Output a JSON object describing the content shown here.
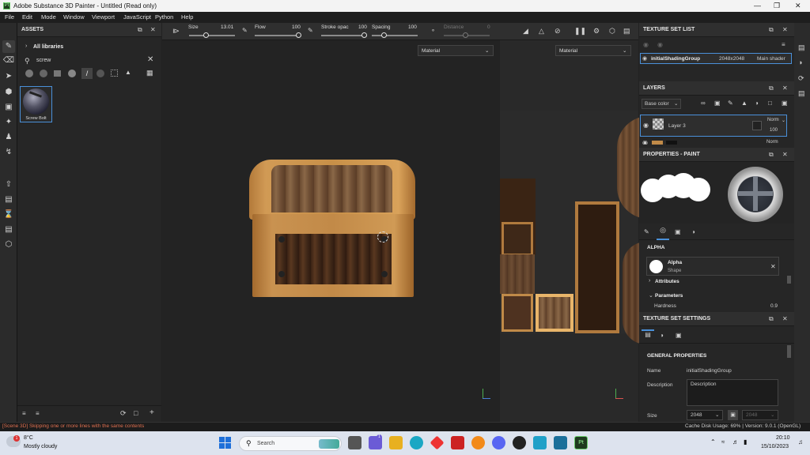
{
  "window": {
    "title": "Adobe Substance 3D Painter - Untitled (Read only)",
    "app_icon": "Pt"
  },
  "menu": [
    "File",
    "Edit",
    "Mode",
    "Window",
    "Viewport",
    "JavaScript",
    "Python",
    "Help"
  ],
  "assets": {
    "header": "ASSETS",
    "library": "All libraries",
    "search_value": "screw",
    "items": [
      {
        "label": "Screw Bolt"
      }
    ]
  },
  "toolbar": {
    "size_label": "Size",
    "size_value": "13.01",
    "flow_label": "Flow",
    "flow_value": "100",
    "stroke_label": "Stroke opac",
    "stroke_value": "100",
    "spacing_label": "Spacing",
    "spacing_value": "100",
    "distance_label": "Distance",
    "distance_value": "0"
  },
  "viewport": {
    "left_mode": "Material",
    "right_mode": "Material"
  },
  "texture_set_list": {
    "header": "TEXTURE SET LIST",
    "name": "initialShadingGroup",
    "resolution": "2048x2048",
    "shader": "Main shader"
  },
  "layers": {
    "header": "LAYERS",
    "channel": "Base color",
    "items": [
      {
        "name": "Layer 3",
        "blend": "Norm",
        "opacity": "100"
      },
      {
        "name": "",
        "blend": "Norm",
        "opacity": ""
      }
    ]
  },
  "properties": {
    "header": "PROPERTIES - PAINT",
    "alpha_section": "ALPHA",
    "alpha_name": "Alpha",
    "alpha_sub": "Shape",
    "attributes": "Attributes",
    "parameters": "Parameters",
    "hardness_label": "Hardness",
    "hardness_value": "0.9"
  },
  "texture_set_settings": {
    "header": "TEXTURE SET SETTINGS",
    "section": "GENERAL PROPERTIES",
    "name_label": "Name",
    "name_value": "initialShadingGroup",
    "desc_label": "Description",
    "desc_value": "Description",
    "size_label": "Size",
    "size_value": "2048",
    "size_value2": "2048"
  },
  "status": {
    "message": "[Scene 3D] Skipping one or more lines with the same contents",
    "cache": "Cache Disk Usage:   69%  |  Version: 9.0.1 (OpenGL)"
  },
  "taskbar": {
    "weather_temp": "8°C",
    "weather_desc": "Mostly cloudy",
    "weather_badge": "1",
    "search_placeholder": "Search",
    "time": "20:10",
    "date": "15/10/2023",
    "chat_badge": "1"
  },
  "colors": {
    "accent": "#4a90d9",
    "status_error": "#e07050",
    "bg_panel": "#262626"
  }
}
